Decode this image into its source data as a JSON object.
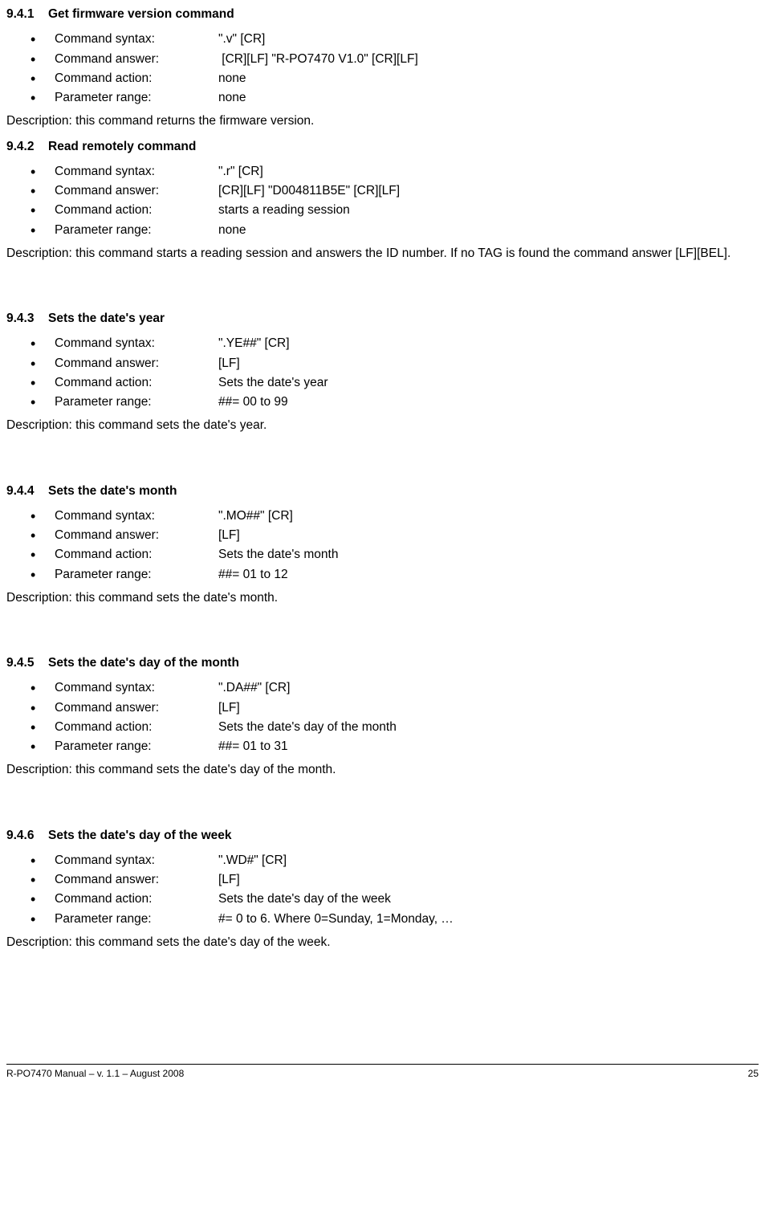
{
  "sections": [
    {
      "number": "9.4.1",
      "title": "Get firmware version command",
      "items": [
        {
          "label": "Command syntax:",
          "value": "\".v\" [CR]"
        },
        {
          "label": "Command answer:",
          "value": " [CR][LF] \"R-PO7470 V1.0\" [CR][LF]"
        },
        {
          "label": "Command action:",
          "value": "none"
        },
        {
          "label": "Parameter range:",
          "value": "none"
        }
      ],
      "description": "Description: this command returns the firmware version.",
      "justify": false,
      "first": true
    },
    {
      "number": "9.4.2",
      "title": "Read remotely command",
      "items": [
        {
          "label": "Command syntax:",
          "value": "\".r\" [CR]"
        },
        {
          "label": "Command answer:",
          "value": "[CR][LF] \"D004811B5E\" [CR][LF]"
        },
        {
          "label": "Command action:",
          "value": "starts a reading session"
        },
        {
          "label": "Parameter range:",
          "value": "none"
        }
      ],
      "description": "Description: this command starts a reading session and answers the ID number. If no TAG is found the command answer [LF][BEL].",
      "justify": true,
      "spaced_after": true
    },
    {
      "number": "9.4.3",
      "title": "Sets the date's year",
      "items": [
        {
          "label": "Command syntax:",
          "value": "\".YE##\" [CR]"
        },
        {
          "label": "Command answer:",
          "value": "[LF]"
        },
        {
          "label": "Command action:",
          "value": "Sets the date's year"
        },
        {
          "label": "Parameter range:",
          "value": "##= 00 to 99"
        }
      ],
      "description": "Description: this command sets the date's year.",
      "justify": false,
      "spaced_before": true,
      "spaced_after": true
    },
    {
      "number": "9.4.4",
      "title": "Sets the date's month",
      "items": [
        {
          "label": "Command syntax:",
          "value": "\".MO##\" [CR]"
        },
        {
          "label": "Command answer:",
          "value": "[LF]"
        },
        {
          "label": "Command action:",
          "value": "Sets the date's month"
        },
        {
          "label": "Parameter range:",
          "value": "##= 01 to 12"
        }
      ],
      "description": "Description: this command sets the date's month.",
      "justify": false,
      "spaced_before": true,
      "spaced_after": true
    },
    {
      "number": "9.4.5",
      "title": "Sets the date's day of the month",
      "items": [
        {
          "label": "Command syntax:",
          "value": "\".DA##\" [CR]"
        },
        {
          "label": "Command answer:",
          "value": "[LF]"
        },
        {
          "label": "Command action:",
          "value": "Sets the date's day of the month"
        },
        {
          "label": "Parameter range:",
          "value": "##= 01 to 31"
        }
      ],
      "description": "Description: this command sets the date's day of the month.",
      "justify": false,
      "spaced_before": true,
      "spaced_after": true
    },
    {
      "number": "9.4.6",
      "title": "Sets the date's day of the week",
      "items": [
        {
          "label": "Command syntax:",
          "value": "\".WD#\" [CR]"
        },
        {
          "label": "Command answer:",
          "value": "[LF]"
        },
        {
          "label": "Command action:",
          "value": "Sets the date's day of the week"
        },
        {
          "label": "Parameter range:",
          "value": "#= 0 to 6. Where 0=Sunday, 1=Monday, …"
        }
      ],
      "description": "Description: this command sets the date's day of the week.",
      "justify": false,
      "spaced_before": true
    }
  ],
  "footer": {
    "left": "R-PO7470 Manual – v. 1.1 – August 2008",
    "right": "25"
  }
}
